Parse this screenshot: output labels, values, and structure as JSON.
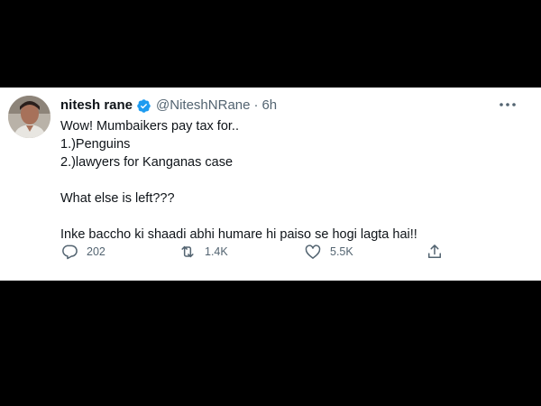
{
  "tweet": {
    "author": {
      "display_name": "nitesh rane",
      "handle": "@NiteshNRane",
      "separator": "·",
      "time": "6h",
      "verified": true
    },
    "text_lines": [
      "Wow! Mumbaikers pay tax for..",
      "1.)Penguins",
      "2.)lawyers for Kanganas case",
      "",
      "What else is left???",
      "",
      "Inke baccho ki shaadi abhi humare hi paiso se hogi lagta hai!!"
    ],
    "actions": {
      "reply_count": "202",
      "retweet_count": "1.4K",
      "like_count": "5.5K"
    }
  },
  "icons": {
    "verified": "verified-badge-icon",
    "more": "more-dots-icon",
    "reply": "reply-icon",
    "retweet": "retweet-icon",
    "like": "heart-icon",
    "share": "share-icon"
  },
  "colors": {
    "background": "#000000",
    "card": "#ffffff",
    "text": "#0f1419",
    "muted": "#536471",
    "verified": "#1d9bf0"
  }
}
